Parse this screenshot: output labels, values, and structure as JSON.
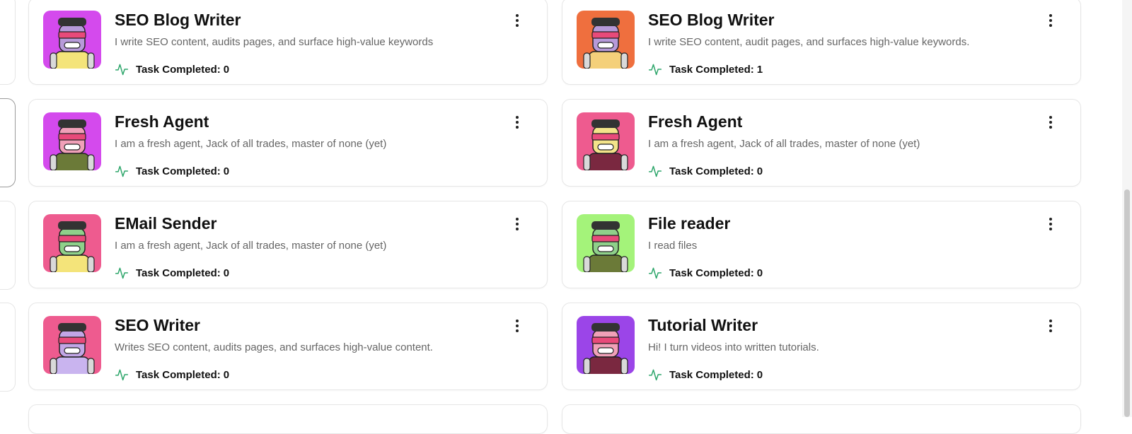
{
  "agents": [
    {
      "name": "SEO Blog Writer",
      "description": "I write SEO content, audits pages, and surface high-value keywords",
      "task_label": "Task Completed:",
      "task_count": "0",
      "avatar_bg": "#d44aed"
    },
    {
      "name": "SEO Blog Writer",
      "description": "I write SEO content, audit pages, and surfaces high-value keywords.",
      "task_label": "Task Completed:",
      "task_count": "1",
      "avatar_bg": "#ef6f3e"
    },
    {
      "name": "Fresh Agent",
      "description": "I am a fresh agent, Jack of all trades, master of none (yet)",
      "task_label": "Task Completed:",
      "task_count": "0",
      "avatar_bg": "#d44aed"
    },
    {
      "name": "Fresh Agent",
      "description": "I am a fresh agent, Jack of all trades, master of none (yet)",
      "task_label": "Task Completed:",
      "task_count": "0",
      "avatar_bg": "#ee5b8f"
    },
    {
      "name": "EMail Sender",
      "description": "I am a fresh agent, Jack of all trades, master of none (yet)",
      "task_label": "Task Completed:",
      "task_count": "0",
      "avatar_bg": "#ee5b8f"
    },
    {
      "name": "File reader",
      "description": "I read files",
      "task_label": "Task Completed:",
      "task_count": "0",
      "avatar_bg": "#a4f37a"
    },
    {
      "name": "SEO Writer",
      "description": "Writes SEO content, audits pages, and surfaces high-value content.",
      "task_label": "Task Completed:",
      "task_count": "0",
      "avatar_bg": "#ee5b8f"
    },
    {
      "name": "Tutorial Writer",
      "description": "Hi! I turn videos into written tutorials.",
      "task_label": "Task Completed:",
      "task_count": "0",
      "avatar_bg": "#9b45e8"
    }
  ],
  "icons": {
    "activity": "activity-icon",
    "menu": "more-vertical-icon"
  },
  "colors": {
    "activity_green": "#2ea66b",
    "card_border": "#e6e6e6"
  }
}
